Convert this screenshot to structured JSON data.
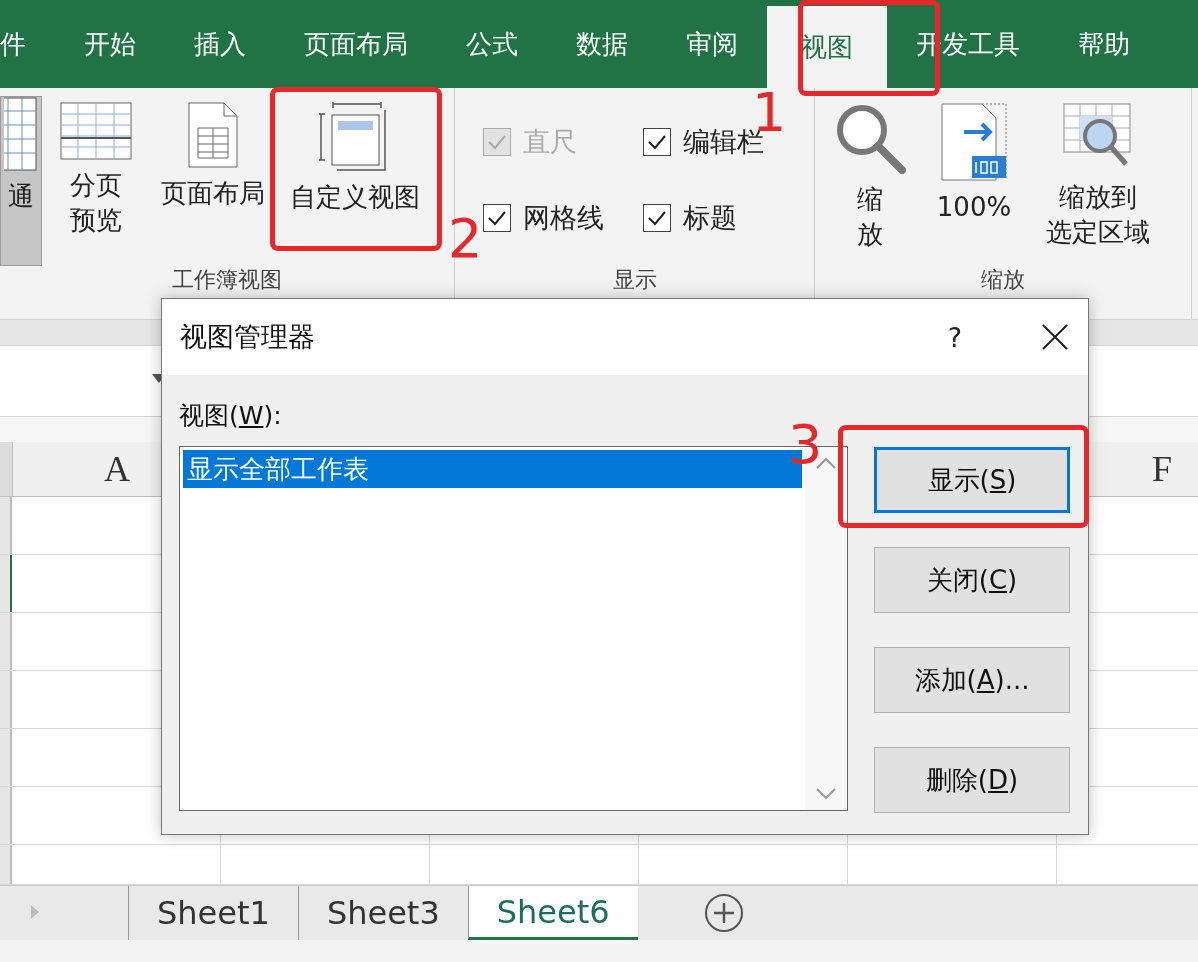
{
  "ribbon_tabs": [
    {
      "label": "件",
      "selected": false
    },
    {
      "label": "开始",
      "selected": false
    },
    {
      "label": "插入",
      "selected": false
    },
    {
      "label": "页面布局",
      "selected": false
    },
    {
      "label": "公式",
      "selected": false
    },
    {
      "label": "数据",
      "selected": false
    },
    {
      "label": "审阅",
      "selected": false
    },
    {
      "label": "视图",
      "selected": true
    },
    {
      "label": "开发工具",
      "selected": false
    },
    {
      "label": "帮助",
      "selected": false
    }
  ],
  "ribbon_groups": [
    {
      "kind": "buttons",
      "label": "工作簿视图",
      "items": [
        {
          "lines": [
            "通"
          ],
          "selected": true
        },
        {
          "lines": [
            "分页",
            "预览"
          ],
          "selected": false
        },
        {
          "lines": [
            "页面布局"
          ],
          "selected": false
        },
        {
          "lines": [
            "自定义视图"
          ],
          "selected": false
        }
      ]
    },
    {
      "kind": "checks",
      "label": "显示",
      "items": [
        {
          "label": "直尺",
          "checked": true,
          "disabled": true
        },
        {
          "label": "编辑栏",
          "checked": true,
          "disabled": false
        },
        {
          "label": "网格线",
          "checked": true,
          "disabled": false
        },
        {
          "label": "标题",
          "checked": true,
          "disabled": false
        }
      ]
    },
    {
      "kind": "buttons",
      "label": "缩放",
      "items": [
        {
          "lines": [
            "缩",
            "放"
          ],
          "selected": false
        },
        {
          "lines": [
            "100%"
          ],
          "selected": false
        },
        {
          "lines": [
            "缩放到",
            "选定区域"
          ],
          "selected": false
        }
      ]
    }
  ],
  "grid": {
    "visible_columns": [
      "A",
      "F"
    ]
  },
  "sheet_tabs": [
    {
      "label": "Sheet1",
      "selected": false
    },
    {
      "label": "Sheet3",
      "selected": false
    },
    {
      "label": "Sheet6",
      "selected": true
    }
  ],
  "dialog": {
    "title": "视图管理器",
    "help": "?",
    "list_label": {
      "before": "视图(",
      "key": "W",
      "after": "):"
    },
    "views": [
      {
        "label": "显示全部工作表",
        "selected": true
      }
    ],
    "buttons": [
      {
        "before": "显示(",
        "key": "S",
        "after": ")",
        "default": true
      },
      {
        "before": "关闭(",
        "key": "C",
        "after": ")",
        "default": false
      },
      {
        "before": "添加(",
        "key": "A",
        "after": ")...",
        "default": false
      },
      {
        "before": "删除(",
        "key": "D",
        "after": ")",
        "default": false
      }
    ]
  },
  "annotations": [
    {
      "label": "1"
    },
    {
      "label": "2"
    },
    {
      "label": "3"
    }
  ]
}
